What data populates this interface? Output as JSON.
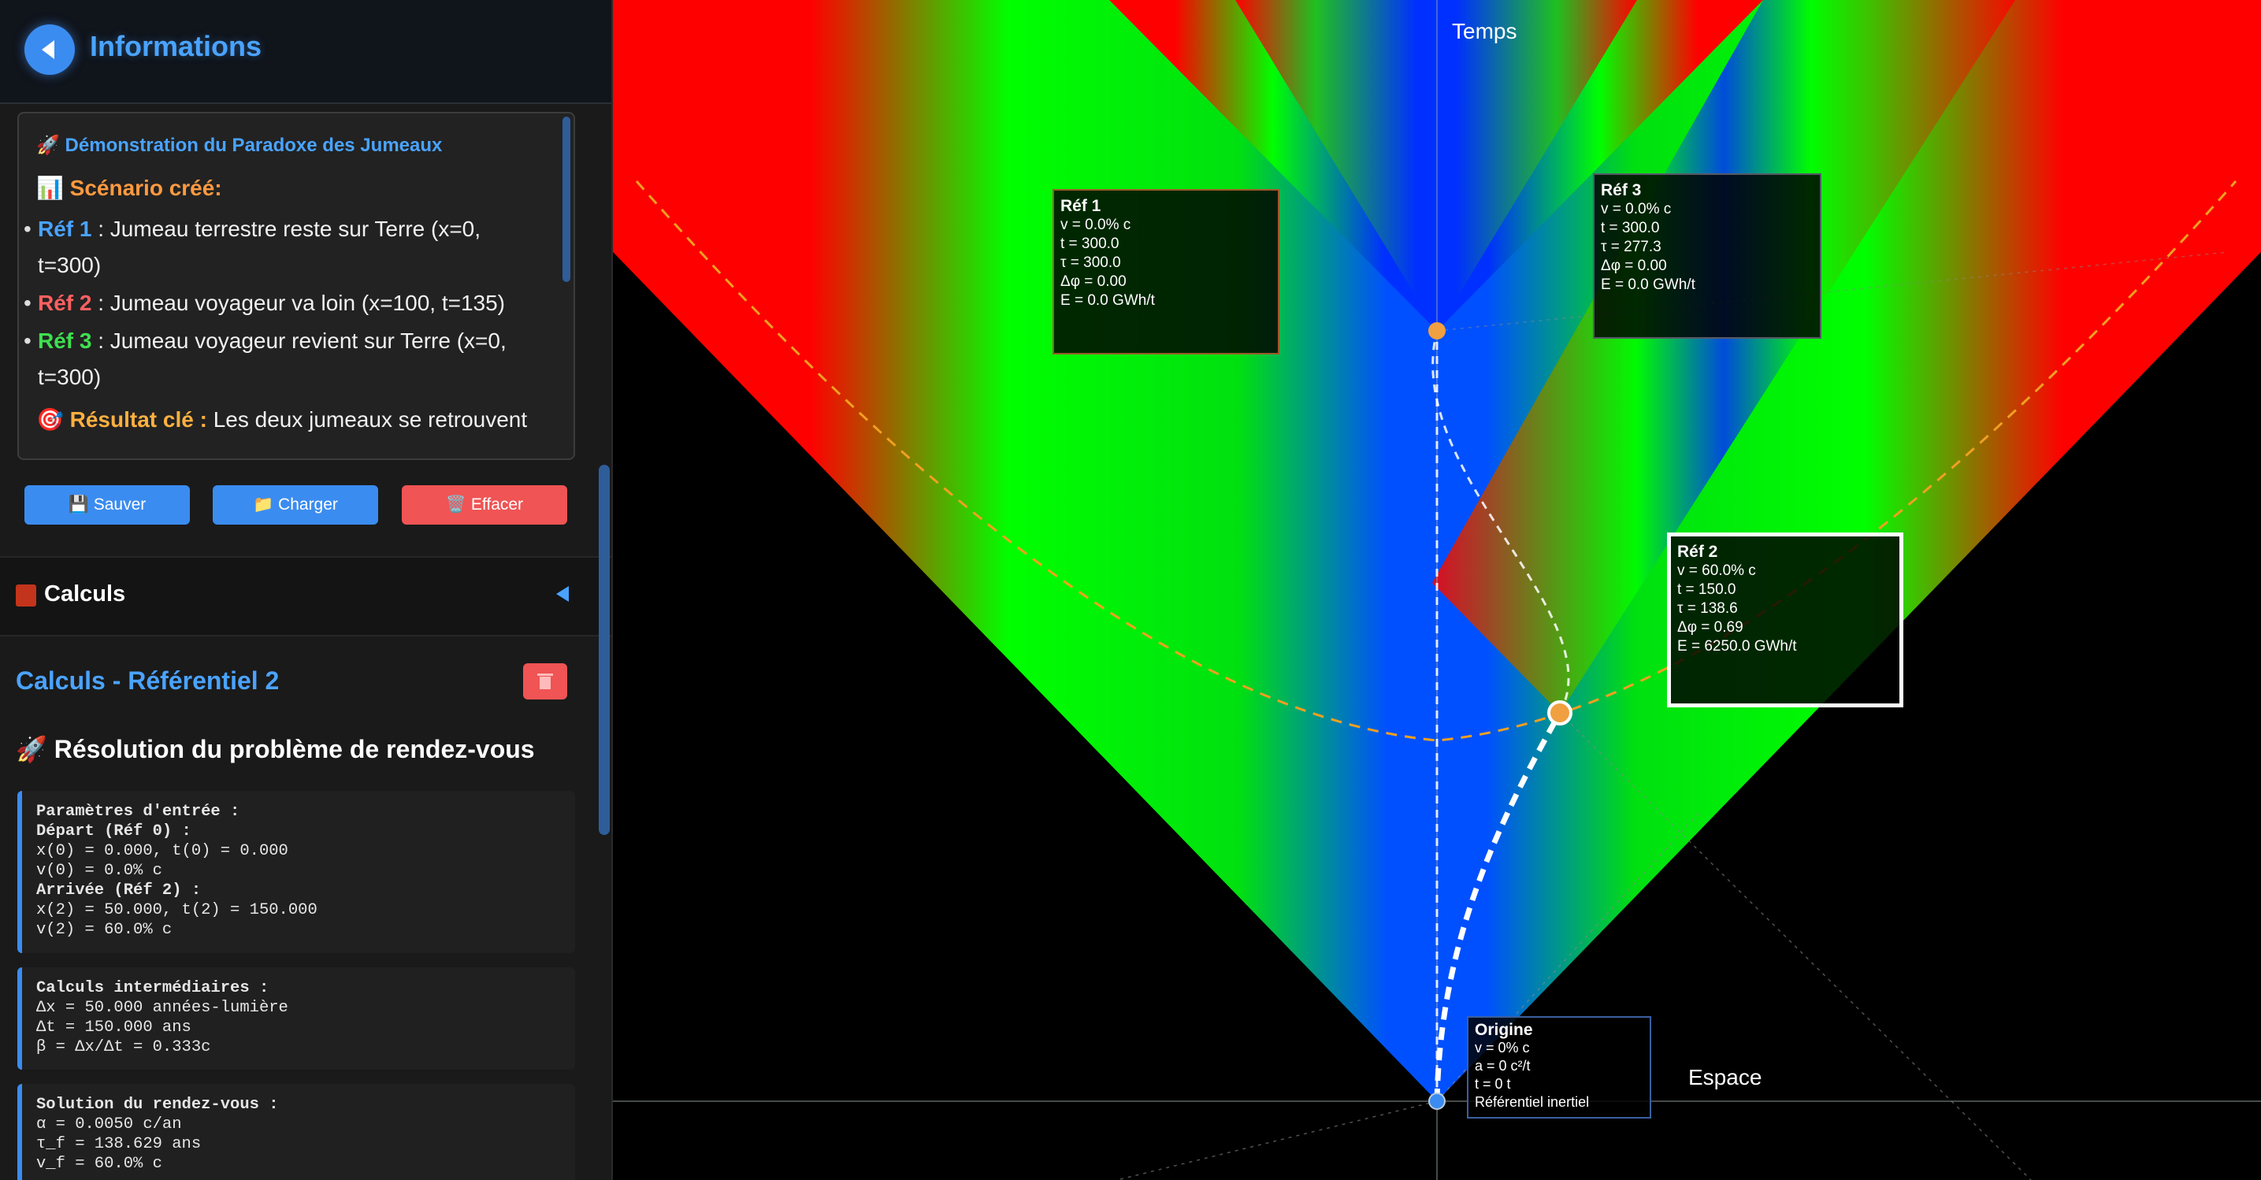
{
  "header": {
    "title": "Informations"
  },
  "info": {
    "heading": "🚀 Démonstration du Paradoxe des Jumeaux",
    "scenario": "📊 Scénario créé:",
    "items": [
      {
        "ref": "Réf 1",
        "text": " : Jumeau terrestre reste sur Terre (x=0,",
        "cont": "t=300)"
      },
      {
        "ref": "Réf 2",
        "text": " : Jumeau voyageur va loin (x=100, t=135)"
      },
      {
        "ref": "Réf 3",
        "text": " : Jumeau voyageur revient sur Terre (x=0,",
        "cont": "t=300)"
      }
    ],
    "result_label": "🎯 Résultat clé :",
    "result_text": " Les deux jumeaux se retrouvent"
  },
  "buttons": {
    "save": "💾 Sauver",
    "load": "📁 Charger",
    "clear": "🗑️ Effacer"
  },
  "calc_section": {
    "label": "Calculs"
  },
  "calc": {
    "title": "Calculs - Référentiel 2",
    "problem": "🚀 Résolution du problème de rendez-vous",
    "params": [
      [
        "b",
        "Paramètres d'entrée :"
      ],
      [
        "b",
        "Départ (Réf 0) :"
      ],
      [
        "",
        "x(0) = 0.000, t(0) = 0.000"
      ],
      [
        "",
        "v(0) = 0.0% c"
      ],
      [
        "b",
        "Arrivée (Réf 2) :"
      ],
      [
        "",
        "x(2) = 50.000, t(2) = 150.000"
      ],
      [
        "",
        "v(2) = 60.0% c"
      ]
    ],
    "intermediate": [
      [
        "b",
        "Calculs intermédiaires :"
      ],
      [
        "",
        "Δx = 50.000 années-lumière"
      ],
      [
        "",
        "Δt = 150.000 ans"
      ],
      [
        "",
        "β = Δx/Δt = 0.333c"
      ]
    ],
    "solution": [
      [
        "b",
        "Solution du rendez-vous :"
      ],
      [
        "",
        "α = 0.0050 c/an"
      ],
      [
        "",
        "τ_f = 138.629 ans"
      ],
      [
        "",
        "v_f = 60.0% c"
      ]
    ]
  },
  "diagram": {
    "time_label": "Temps",
    "space_label": "Espace",
    "refs": {
      "ref1": {
        "title": "Réf 1",
        "lines": [
          "v = 0.0% c",
          "t = 300.0",
          "τ = 300.0",
          "Δφ = 0.00",
          "E = 0.0 GWh/t"
        ]
      },
      "ref3": {
        "title": "Réf 3",
        "lines": [
          "v = 0.0% c",
          "t = 300.0",
          "τ = 277.3",
          "Δφ = 0.00",
          "E = 0.0 GWh/t"
        ]
      },
      "ref2": {
        "title": "Réf 2",
        "lines": [
          "v = 60.0% c",
          "t = 150.0",
          "τ = 138.6",
          "Δφ = 0.69",
          "E = 6250.0 GWh/t"
        ]
      },
      "origin": {
        "title": "Origine",
        "lines": [
          "v = 0% c",
          "a = 0 c²/t",
          "t = 0 t",
          "Référentiel inertiel"
        ]
      }
    }
  }
}
